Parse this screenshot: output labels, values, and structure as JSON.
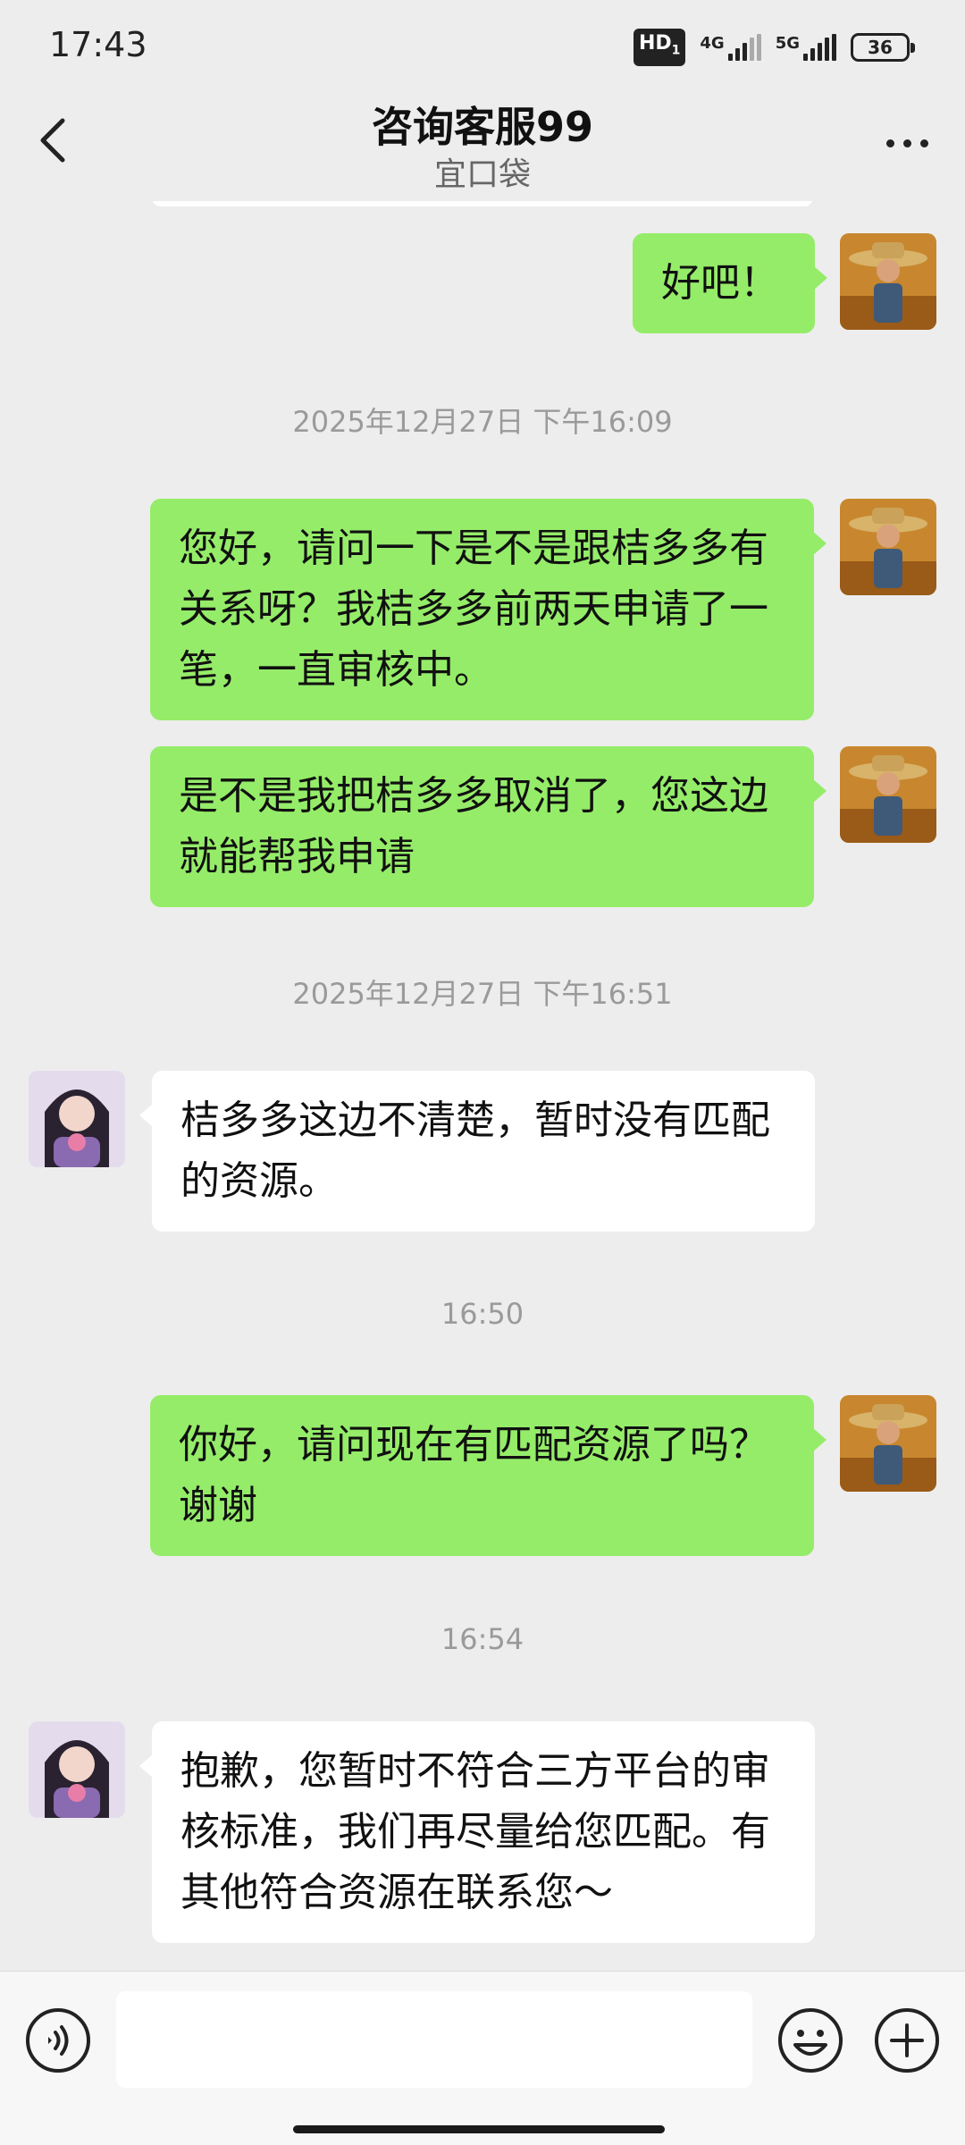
{
  "status_bar": {
    "time": "17:43",
    "hd_label": "HD",
    "hd_sub": "1",
    "network_1": "4G",
    "network_2": "5G",
    "battery": "36"
  },
  "header": {
    "title": "咨询客服99",
    "subtitle": "宜口袋"
  },
  "messages": [
    {
      "type": "sent",
      "text": "好吧！"
    },
    {
      "type": "time",
      "text": "2025年12月27日 下午16:09"
    },
    {
      "type": "sent",
      "text": "您好，请问一下是不是跟桔多多有关系呀？我桔多多前两天申请了一笔，一直审核中。"
    },
    {
      "type": "sent",
      "text": "是不是我把桔多多取消了，您这边就能帮我申请"
    },
    {
      "type": "time",
      "text": "2025年12月27日 下午16:51"
    },
    {
      "type": "recv",
      "text": "桔多多这边不清楚，暂时没有匹配的资源。"
    },
    {
      "type": "time",
      "text": "16:50"
    },
    {
      "type": "sent",
      "text": "你好，请问现在有匹配资源了吗？谢谢"
    },
    {
      "type": "time",
      "text": "16:54"
    },
    {
      "type": "recv",
      "text": "抱歉，您暂时不符合三方平台的审核标准，我们再尽量给您匹配。有其他符合资源在联系您～"
    }
  ],
  "input_bar": {
    "placeholder": ""
  },
  "colors": {
    "background": "#ededed",
    "sent_bubble": "#95ec69",
    "received_bubble": "#ffffff",
    "timestamp_text": "#9a9a9a"
  }
}
